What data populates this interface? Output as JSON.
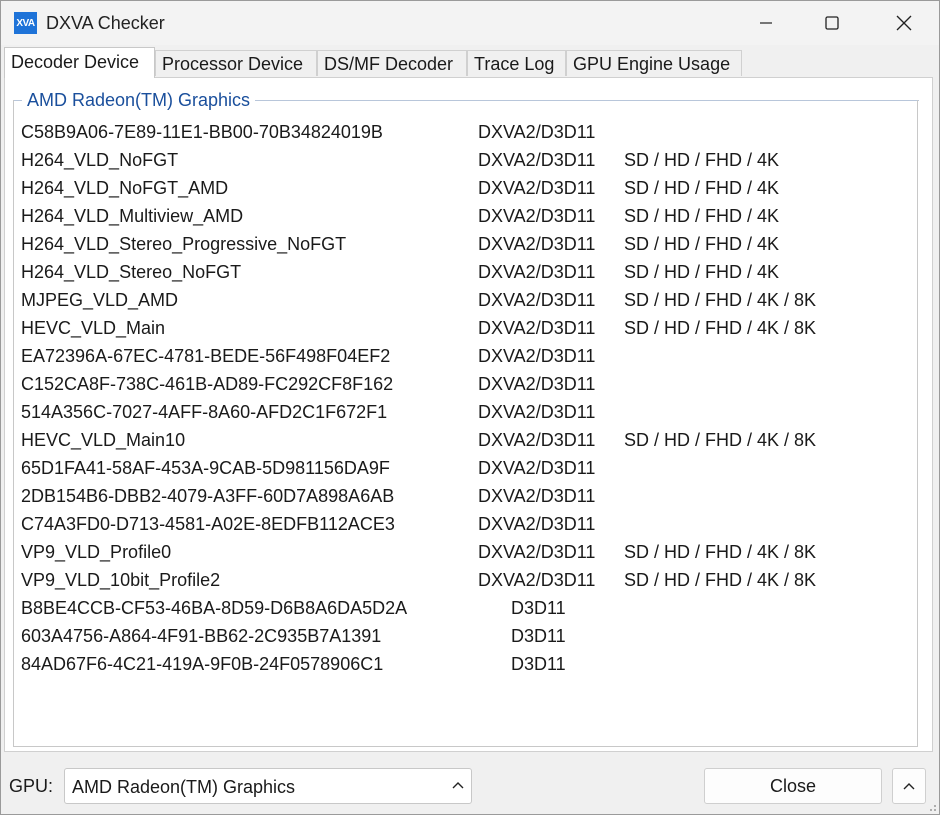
{
  "window": {
    "title": "DXVA Checker",
    "app_icon_text": "XVA"
  },
  "tabs": [
    {
      "label": "Decoder Device",
      "active": true
    },
    {
      "label": "Processor Device",
      "active": false
    },
    {
      "label": "DS/MF Decoder",
      "active": false
    },
    {
      "label": "Trace Log",
      "active": false
    },
    {
      "label": "GPU Engine Usage",
      "active": false
    }
  ],
  "group": {
    "title": "AMD Radeon(TM) Graphics"
  },
  "rows": [
    {
      "name": "C58B9A06-7E89-11E1-BB00-70B34824019B",
      "api": "DXVA2/D3D11",
      "res": ""
    },
    {
      "name": "H264_VLD_NoFGT",
      "api": "DXVA2/D3D11",
      "res": "SD / HD / FHD / 4K"
    },
    {
      "name": "H264_VLD_NoFGT_AMD",
      "api": "DXVA2/D3D11",
      "res": "SD / HD / FHD / 4K"
    },
    {
      "name": "H264_VLD_Multiview_AMD",
      "api": "DXVA2/D3D11",
      "res": "SD / HD / FHD / 4K"
    },
    {
      "name": "H264_VLD_Stereo_Progressive_NoFGT",
      "api": "DXVA2/D3D11",
      "res": "SD / HD / FHD / 4K"
    },
    {
      "name": "H264_VLD_Stereo_NoFGT",
      "api": "DXVA2/D3D11",
      "res": "SD / HD / FHD / 4K"
    },
    {
      "name": "MJPEG_VLD_AMD",
      "api": "DXVA2/D3D11",
      "res": "SD / HD / FHD / 4K / 8K"
    },
    {
      "name": "HEVC_VLD_Main",
      "api": "DXVA2/D3D11",
      "res": "SD / HD / FHD / 4K / 8K"
    },
    {
      "name": "EA72396A-67EC-4781-BEDE-56F498F04EF2",
      "api": "DXVA2/D3D11",
      "res": ""
    },
    {
      "name": "C152CA8F-738C-461B-AD89-FC292CF8F162",
      "api": "DXVA2/D3D11",
      "res": ""
    },
    {
      "name": "514A356C-7027-4AFF-8A60-AFD2C1F672F1",
      "api": "DXVA2/D3D11",
      "res": ""
    },
    {
      "name": "HEVC_VLD_Main10",
      "api": "DXVA2/D3D11",
      "res": "SD / HD / FHD / 4K / 8K"
    },
    {
      "name": "65D1FA41-58AF-453A-9CAB-5D981156DA9F",
      "api": "DXVA2/D3D11",
      "res": ""
    },
    {
      "name": "2DB154B6-DBB2-4079-A3FF-60D7A898A6AB",
      "api": "DXVA2/D3D11",
      "res": ""
    },
    {
      "name": "C74A3FD0-D713-4581-A02E-8EDFB112ACE3",
      "api": "DXVA2/D3D11",
      "res": ""
    },
    {
      "name": "VP9_VLD_Profile0",
      "api": "DXVA2/D3D11",
      "res": "SD / HD / FHD / 4K / 8K"
    },
    {
      "name": "VP9_VLD_10bit_Profile2",
      "api": "DXVA2/D3D11",
      "res": "SD / HD / FHD / 4K / 8K"
    },
    {
      "name": "B8BE4CCB-CF53-46BA-8D59-D6B8A6DA5D2A",
      "api": "D3D11",
      "res": ""
    },
    {
      "name": "603A4756-A864-4F91-BB62-2C935B7A1391",
      "api": "D3D11",
      "res": ""
    },
    {
      "name": "84AD67F6-4C21-419A-9F0B-24F0578906C1",
      "api": "D3D11",
      "res": ""
    }
  ],
  "footer": {
    "gpu_label": "GPU:",
    "gpu_value": "AMD Radeon(TM) Graphics",
    "close_label": "Close"
  },
  "icons": {
    "minimize": "minimize-icon",
    "maximize": "maximize-icon",
    "close": "close-icon",
    "dropdown": "chevron-up-icon",
    "expand": "chevron-up-icon"
  }
}
